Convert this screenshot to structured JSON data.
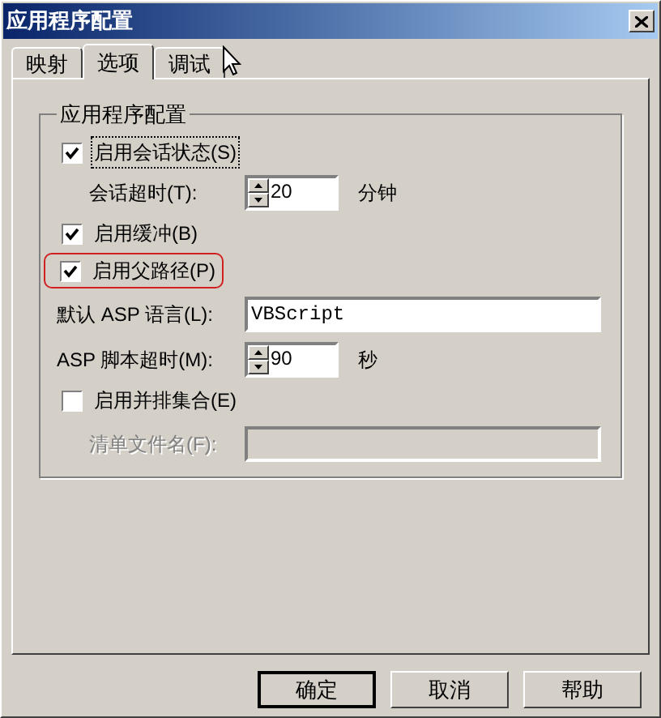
{
  "window": {
    "title": "应用程序配置"
  },
  "tabs": [
    {
      "label": "映射",
      "selected": false
    },
    {
      "label": "选项",
      "selected": true
    },
    {
      "label": "调试",
      "selected": false
    }
  ],
  "group": {
    "title": "应用程序配置",
    "rows": [
      {
        "kind": "checkbox",
        "label": "启用会话状态(S)",
        "checked": true,
        "focused": true,
        "highlighted": false,
        "indented": false
      },
      {
        "kind": "spinner",
        "label": "会话超时(T):",
        "value": "20",
        "unit": "分钟",
        "indented": true
      },
      {
        "kind": "checkbox",
        "label": "启用缓冲(B)",
        "checked": true,
        "focused": false,
        "highlighted": false,
        "indented": false
      },
      {
        "kind": "checkbox",
        "label": "启用父路径(P)",
        "checked": true,
        "focused": false,
        "highlighted": true,
        "indented": false
      },
      {
        "kind": "text",
        "label": "默认 ASP 语言(L):",
        "value": "VBScript",
        "disabled": false,
        "indented": false
      },
      {
        "kind": "spinner",
        "label": "ASP 脚本超时(M):",
        "value": "90",
        "unit": "秒",
        "indented": false
      },
      {
        "kind": "checkbox",
        "label": "启用并排集合(E)",
        "checked": false,
        "focused": false,
        "highlighted": false,
        "indented": false
      },
      {
        "kind": "text",
        "label": "清单文件名(F):",
        "disabled": true,
        "indented": true
      }
    ]
  },
  "buttons": [
    {
      "label": "确定",
      "default": true
    },
    {
      "label": "取消",
      "default": false
    },
    {
      "label": "帮助",
      "default": false
    }
  ]
}
